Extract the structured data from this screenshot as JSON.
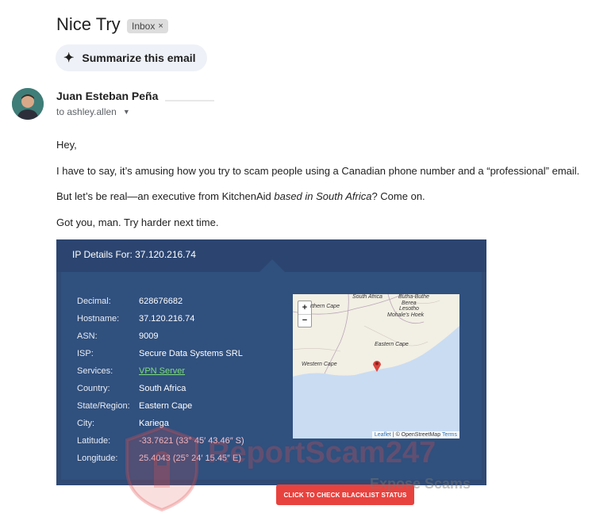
{
  "email": {
    "subject": "Nice Try",
    "label_chip": "Inbox",
    "summarize_label": "Summarize this email",
    "sender_name": "Juan Esteban Peña",
    "to_line": "to ashley.allen",
    "body": [
      "Hey,",
      "I have to say, it’s amusing how you try to scam people using a Canadian phone number and a “professional” email.",
      "But let’s be real—an executive from KitchenAid based in South Africa? Come on.",
      "Got you, man. Try harder next time."
    ],
    "para3_prefix": "But let’s be real—an executive from KitchenAid ",
    "para3_italic": "based in South Africa",
    "para3_suffix": "? Come on."
  },
  "ip_card": {
    "title": "IP Details For: 37.120.216.74",
    "rows": [
      {
        "label": "Decimal:",
        "value": "628676682"
      },
      {
        "label": "Hostname:",
        "value": "37.120.216.74"
      },
      {
        "label": "ASN:",
        "value": "9009"
      },
      {
        "label": "ISP:",
        "value": "Secure Data Systems SRL"
      },
      {
        "label": "Services:",
        "value": "VPN Server"
      },
      {
        "label": "Country:",
        "value": "South Africa"
      },
      {
        "label": "State/Region:",
        "value": "Eastern Cape"
      },
      {
        "label": "City:",
        "value": "Kariega"
      },
      {
        "label": "Latitude:",
        "value": "-33.7621  (33° 45′ 43.46″ S)"
      },
      {
        "label": "Longitude:",
        "value": "25.4043  (25° 24′ 15.45″ E)"
      }
    ],
    "check_button": "CLICK TO CHECK BLACKLIST STATUS",
    "map": {
      "zoom_in": "+",
      "zoom_out": "−",
      "labels": {
        "northern_cape": "rthern Cape",
        "south_africa": "South Africa",
        "butha_buthe": "Butha-Buthe",
        "berea": "Berea",
        "lesotho": "Lesotho",
        "mohales_hoek": "Mohale's Hoek",
        "eastern_cape": "Eastern Cape",
        "western_cape": "Western Cape"
      },
      "attribution_leaflet": "Leaflet",
      "attribution_osm": "| © OpenStreetMap",
      "attribution_terms": "Terms"
    }
  },
  "watermark": {
    "text": "ReportScam247",
    "sub": "Expose Scams"
  },
  "colors": {
    "card_bg": "#2f4a74",
    "link_green": "#7ddc7a",
    "button_red": "#e8423e",
    "sea": "#c9dcf2"
  }
}
